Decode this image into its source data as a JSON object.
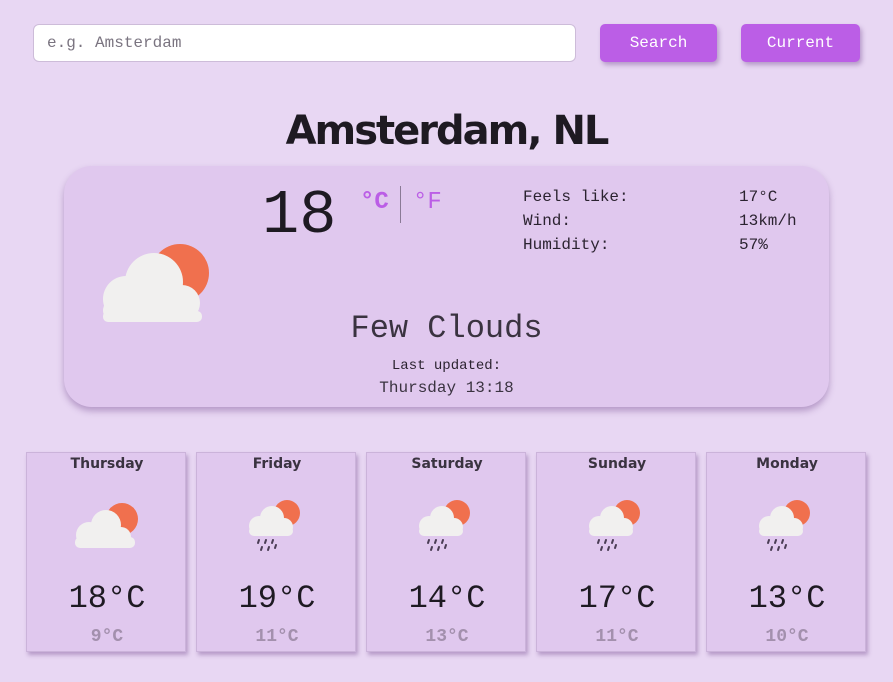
{
  "search": {
    "placeholder": "e.g. Amsterdam",
    "value": ""
  },
  "buttons": {
    "search_label": "Search",
    "current_label": "Current"
  },
  "city": "Amsterdam, NL",
  "current": {
    "temperature": "18",
    "unit_celsius": "°C",
    "unit_fahrenheit": "°F",
    "feels_like_label": "Feels like:",
    "feels_like_value": "17°C",
    "wind_label": "Wind:",
    "wind_value": "13km/h",
    "humidity_label": "Humidity:",
    "humidity_value": "57%",
    "description": "Few Clouds",
    "updated_label": "Last updated:",
    "updated_time": "Thursday 13:18",
    "icon": "few-clouds-icon"
  },
  "forecast": [
    {
      "day": "Thursday",
      "max": "18°C",
      "min": "9°C",
      "icon": "few-clouds-icon"
    },
    {
      "day": "Friday",
      "max": "19°C",
      "min": "11°C",
      "icon": "rain-icon"
    },
    {
      "day": "Saturday",
      "max": "14°C",
      "min": "13°C",
      "icon": "rain-icon"
    },
    {
      "day": "Sunday",
      "max": "17°C",
      "min": "11°C",
      "icon": "rain-icon"
    },
    {
      "day": "Monday",
      "max": "13°C",
      "min": "10°C",
      "icon": "rain-icon"
    }
  ],
  "colors": {
    "background": "#e8d7f3",
    "card": "#e0c8ee",
    "accent": "#bb5ee6",
    "sun": "#f0704e",
    "cloud": "#f1f0ef"
  }
}
